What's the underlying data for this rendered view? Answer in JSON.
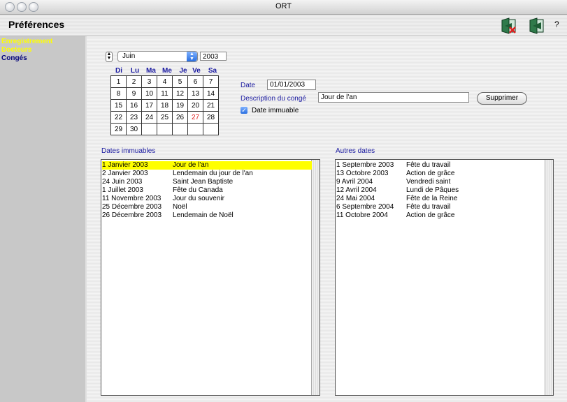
{
  "window": {
    "title": "ORT"
  },
  "header": {
    "title": "Préférences",
    "help": "?"
  },
  "sidebar": {
    "items": [
      {
        "label": "Enregistrement",
        "color": "#ffff00"
      },
      {
        "label": "Docteurs",
        "color": "#ffff00"
      },
      {
        "label": "Congés",
        "color": "#00007a"
      }
    ]
  },
  "calendar": {
    "month": "Juin",
    "year": "2003",
    "days_of_week": [
      "Di",
      "Lu",
      "Ma",
      "Me",
      "Je",
      "Ve",
      "Sa"
    ],
    "weeks": [
      [
        "1",
        "2",
        "3",
        "4",
        "5",
        "6",
        "7"
      ],
      [
        "8",
        "9",
        "10",
        "11",
        "12",
        "13",
        "14"
      ],
      [
        "15",
        "16",
        "17",
        "18",
        "19",
        "20",
        "21"
      ],
      [
        "22",
        "23",
        "24",
        "25",
        "26",
        "27",
        "28"
      ],
      [
        "29",
        "30",
        "",
        "",
        "",
        "",
        ""
      ]
    ],
    "highlight_day": "27",
    "highlight_color": "#e02020"
  },
  "form": {
    "date_label": "Date",
    "date_value": "01/01/2003",
    "description_label": "Description du congé",
    "description_value": "Jour de l'an",
    "delete_button": "Supprimer",
    "immutable_label": "Date immuable",
    "immutable_checked": true
  },
  "fixed_dates": {
    "title": "Dates immuables",
    "rows": [
      {
        "date": "1 Janvier 2003",
        "name": "Jour de l'an"
      },
      {
        "date": "2 Janvier 2003",
        "name": "Lendemain du jour de l'an"
      },
      {
        "date": "24 Juin 2003",
        "name": "Saint Jean Baptiste"
      },
      {
        "date": "1 Juillet 2003",
        "name": "Fête du Canada"
      },
      {
        "date": "11 Novembre 2003",
        "name": "Jour du souvenir"
      },
      {
        "date": "25 Décembre 2003",
        "name": "Noël"
      },
      {
        "date": "26 Décembre 2003",
        "name": "Lendemain de Noël"
      }
    ]
  },
  "other_dates": {
    "title": "Autres dates",
    "rows": [
      {
        "date": "1 Septembre 2003",
        "name": "Fête du travail"
      },
      {
        "date": "13 Octobre 2003",
        "name": "Action de grâce"
      },
      {
        "date": "9 Avril 2004",
        "name": "Vendredi saint"
      },
      {
        "date": "12 Avril 2004",
        "name": "Lundi de Pâques"
      },
      {
        "date": "24 Mai 2004",
        "name": "Fête de la Reine"
      },
      {
        "date": "6 Septembre 2004",
        "name": "Fête du travail"
      },
      {
        "date": "11 Octobre 2004",
        "name": "Action de grâce"
      }
    ]
  },
  "colors": {
    "selection": "#ffff00",
    "label_blue": "#1a1aa0"
  }
}
